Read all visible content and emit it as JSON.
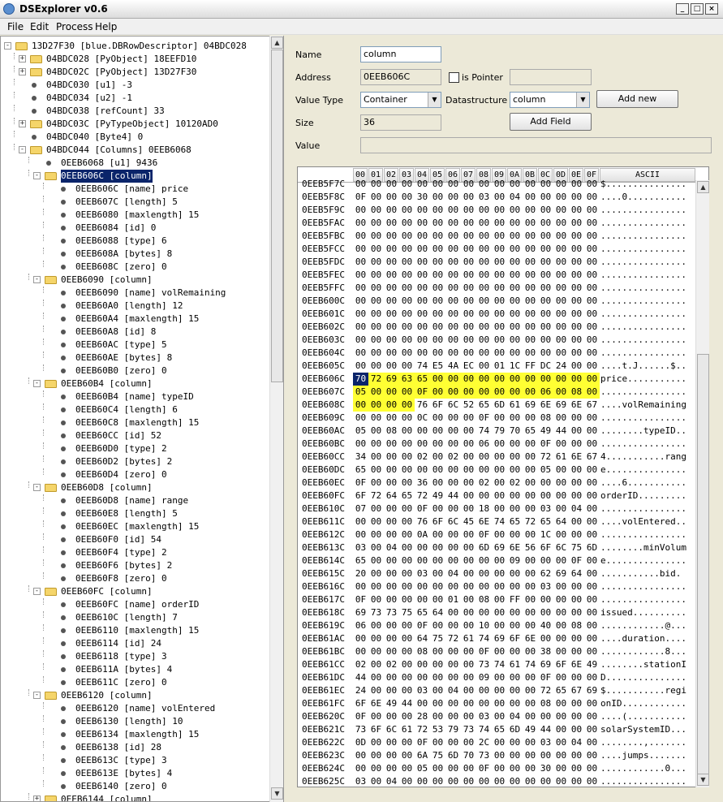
{
  "app": {
    "title": "DSExplorer v0.6"
  },
  "window_controls": {
    "minimize": "_",
    "maximize": "□",
    "close": "×"
  },
  "menu": [
    "File",
    "Edit",
    "Process",
    "Help"
  ],
  "tree": [
    {
      "depth": 0,
      "kind": "folder",
      "exp": "-",
      "text": "13D27F30 [blue.DBRowDescriptor] 04BDC028"
    },
    {
      "depth": 1,
      "kind": "folder",
      "exp": "+",
      "text": "04BDC028 [PyObject] 18EEFD10"
    },
    {
      "depth": 1,
      "kind": "folder",
      "exp": "+",
      "text": "04BDC02C [PyObject] 13D27F30"
    },
    {
      "depth": 1,
      "kind": "leaf",
      "text": "04BDC030 [u1] -3"
    },
    {
      "depth": 1,
      "kind": "leaf",
      "text": "04BDC034 [u2] -1"
    },
    {
      "depth": 1,
      "kind": "leaf",
      "text": "04BDC038 [refCount] 33"
    },
    {
      "depth": 1,
      "kind": "folder",
      "exp": "+",
      "text": "04BDC03C [PyTypeObject] 10120AD0"
    },
    {
      "depth": 1,
      "kind": "leaf",
      "text": "04BDC040 [Byte4] 0"
    },
    {
      "depth": 1,
      "kind": "folder",
      "exp": "-",
      "text": "04BDC044 [Columns] 0EEB6068"
    },
    {
      "depth": 2,
      "kind": "leaf",
      "text": "0EEB6068 [u1] 9436"
    },
    {
      "depth": 2,
      "kind": "folder",
      "exp": "-",
      "text": "0EEB606C [column]",
      "selected": true
    },
    {
      "depth": 3,
      "kind": "leaf",
      "text": "0EEB606C [name] price"
    },
    {
      "depth": 3,
      "kind": "leaf",
      "text": "0EEB607C [length] 5"
    },
    {
      "depth": 3,
      "kind": "leaf",
      "text": "0EEB6080 [maxlength] 15"
    },
    {
      "depth": 3,
      "kind": "leaf",
      "text": "0EEB6084 [id] 0"
    },
    {
      "depth": 3,
      "kind": "leaf",
      "text": "0EEB6088 [type] 6"
    },
    {
      "depth": 3,
      "kind": "leaf",
      "text": "0EEB608A [bytes] 8"
    },
    {
      "depth": 3,
      "kind": "leaf",
      "text": "0EEB608C [zero] 0"
    },
    {
      "depth": 2,
      "kind": "folder",
      "exp": "-",
      "text": "0EEB6090 [column]"
    },
    {
      "depth": 3,
      "kind": "leaf",
      "text": "0EEB6090 [name] volRemaining"
    },
    {
      "depth": 3,
      "kind": "leaf",
      "text": "0EEB60A0 [length] 12"
    },
    {
      "depth": 3,
      "kind": "leaf",
      "text": "0EEB60A4 [maxlength] 15"
    },
    {
      "depth": 3,
      "kind": "leaf",
      "text": "0EEB60A8 [id] 8"
    },
    {
      "depth": 3,
      "kind": "leaf",
      "text": "0EEB60AC [type] 5"
    },
    {
      "depth": 3,
      "kind": "leaf",
      "text": "0EEB60AE [bytes] 8"
    },
    {
      "depth": 3,
      "kind": "leaf",
      "text": "0EEB60B0 [zero] 0"
    },
    {
      "depth": 2,
      "kind": "folder",
      "exp": "-",
      "text": "0EEB60B4 [column]"
    },
    {
      "depth": 3,
      "kind": "leaf",
      "text": "0EEB60B4 [name] typeID"
    },
    {
      "depth": 3,
      "kind": "leaf",
      "text": "0EEB60C4 [length] 6"
    },
    {
      "depth": 3,
      "kind": "leaf",
      "text": "0EEB60C8 [maxlength] 15"
    },
    {
      "depth": 3,
      "kind": "leaf",
      "text": "0EEB60CC [id] 52"
    },
    {
      "depth": 3,
      "kind": "leaf",
      "text": "0EEB60D0 [type] 2"
    },
    {
      "depth": 3,
      "kind": "leaf",
      "text": "0EEB60D2 [bytes] 2"
    },
    {
      "depth": 3,
      "kind": "leaf",
      "text": "0EEB60D4 [zero] 0"
    },
    {
      "depth": 2,
      "kind": "folder",
      "exp": "-",
      "text": "0EEB60D8 [column]"
    },
    {
      "depth": 3,
      "kind": "leaf",
      "text": "0EEB60D8 [name] range"
    },
    {
      "depth": 3,
      "kind": "leaf",
      "text": "0EEB60E8 [length] 5"
    },
    {
      "depth": 3,
      "kind": "leaf",
      "text": "0EEB60EC [maxlength] 15"
    },
    {
      "depth": 3,
      "kind": "leaf",
      "text": "0EEB60F0 [id] 54"
    },
    {
      "depth": 3,
      "kind": "leaf",
      "text": "0EEB60F4 [type] 2"
    },
    {
      "depth": 3,
      "kind": "leaf",
      "text": "0EEB60F6 [bytes] 2"
    },
    {
      "depth": 3,
      "kind": "leaf",
      "text": "0EEB60F8 [zero] 0"
    },
    {
      "depth": 2,
      "kind": "folder",
      "exp": "-",
      "text": "0EEB60FC [column]"
    },
    {
      "depth": 3,
      "kind": "leaf",
      "text": "0EEB60FC [name] orderID"
    },
    {
      "depth": 3,
      "kind": "leaf",
      "text": "0EEB610C [length] 7"
    },
    {
      "depth": 3,
      "kind": "leaf",
      "text": "0EEB6110 [maxlength] 15"
    },
    {
      "depth": 3,
      "kind": "leaf",
      "text": "0EEB6114 [id] 24"
    },
    {
      "depth": 3,
      "kind": "leaf",
      "text": "0EEB6118 [type] 3"
    },
    {
      "depth": 3,
      "kind": "leaf",
      "text": "0EEB611A [bytes] 4"
    },
    {
      "depth": 3,
      "kind": "leaf",
      "text": "0EEB611C [zero] 0"
    },
    {
      "depth": 2,
      "kind": "folder",
      "exp": "-",
      "text": "0EEB6120 [column]"
    },
    {
      "depth": 3,
      "kind": "leaf",
      "text": "0EEB6120 [name] volEntered"
    },
    {
      "depth": 3,
      "kind": "leaf",
      "text": "0EEB6130 [length] 10"
    },
    {
      "depth": 3,
      "kind": "leaf",
      "text": "0EEB6134 [maxlength] 15"
    },
    {
      "depth": 3,
      "kind": "leaf",
      "text": "0EEB6138 [id] 28"
    },
    {
      "depth": 3,
      "kind": "leaf",
      "text": "0EEB613C [type] 3"
    },
    {
      "depth": 3,
      "kind": "leaf",
      "text": "0EEB613E [bytes] 4"
    },
    {
      "depth": 3,
      "kind": "leaf",
      "text": "0EEB6140 [zero] 0"
    },
    {
      "depth": 2,
      "kind": "folder",
      "exp": "+",
      "text": "0EEB6144 [column]"
    }
  ],
  "form": {
    "name_label": "Name",
    "name_value": "column",
    "address_label": "Address",
    "address_value": "0EEB606C",
    "is_pointer_label": "is Pointer",
    "pointer_value": "",
    "value_type_label": "Value Type",
    "value_type_value": "Container",
    "datastructure_label": "Datastructure",
    "datastructure_value": "column",
    "add_new_label": "Add new",
    "size_label": "Size",
    "size_value": "36",
    "add_field_label": "Add Field",
    "value_label": "Value",
    "value_value": ""
  },
  "hex": {
    "columns": [
      "00",
      "01",
      "02",
      "03",
      "04",
      "05",
      "06",
      "07",
      "08",
      "09",
      "0A",
      "0B",
      "0C",
      "0D",
      "0E",
      "0F"
    ],
    "ascii_header": "ASCII",
    "rows": [
      {
        "addr": "0EEB5F7C",
        "bytes": "00 00 00 00 00 00 00 00 00 00 00 00 00 00 00 00",
        "ascii": "$..............."
      },
      {
        "addr": "0EEB5F8C",
        "bytes": "0F 00 00 00 30 00 00 00 03 00 04 00 00 00 00 00",
        "ascii": "....0..........."
      },
      {
        "addr": "0EEB5F9C",
        "bytes": "00 00 00 00 00 00 00 00 00 00 00 00 00 00 00 00",
        "ascii": "................"
      },
      {
        "addr": "0EEB5FAC",
        "bytes": "00 00 00 00 00 00 00 00 00 00 00 00 00 00 00 00",
        "ascii": "................"
      },
      {
        "addr": "0EEB5FBC",
        "bytes": "00 00 00 00 00 00 00 00 00 00 00 00 00 00 00 00",
        "ascii": "................"
      },
      {
        "addr": "0EEB5FCC",
        "bytes": "00 00 00 00 00 00 00 00 00 00 00 00 00 00 00 00",
        "ascii": "................"
      },
      {
        "addr": "0EEB5FDC",
        "bytes": "00 00 00 00 00 00 00 00 00 00 00 00 00 00 00 00",
        "ascii": "................"
      },
      {
        "addr": "0EEB5FEC",
        "bytes": "00 00 00 00 00 00 00 00 00 00 00 00 00 00 00 00",
        "ascii": "................"
      },
      {
        "addr": "0EEB5FFC",
        "bytes": "00 00 00 00 00 00 00 00 00 00 00 00 00 00 00 00",
        "ascii": "................"
      },
      {
        "addr": "0EEB600C",
        "bytes": "00 00 00 00 00 00 00 00 00 00 00 00 00 00 00 00",
        "ascii": "................"
      },
      {
        "addr": "0EEB601C",
        "bytes": "00 00 00 00 00 00 00 00 00 00 00 00 00 00 00 00",
        "ascii": "................"
      },
      {
        "addr": "0EEB602C",
        "bytes": "00 00 00 00 00 00 00 00 00 00 00 00 00 00 00 00",
        "ascii": "................"
      },
      {
        "addr": "0EEB603C",
        "bytes": "00 00 00 00 00 00 00 00 00 00 00 00 00 00 00 00",
        "ascii": "................"
      },
      {
        "addr": "0EEB604C",
        "bytes": "00 00 00 00 00 00 00 00 00 00 00 00 00 00 00 00",
        "ascii": "................"
      },
      {
        "addr": "0EEB605C",
        "bytes": "00 00 00 00 74 E5 4A EC 00 01 1C FF DC 24 00 00",
        "ascii": "....t.J......$.."
      },
      {
        "addr": "0EEB606C",
        "bytes": "70 72 69 63 65 00 00 00 00 00 00 00 00 00 00 00",
        "ascii": "price...........",
        "hl_from": 0,
        "hl_to": 16
      },
      {
        "addr": "0EEB607C",
        "bytes": "05 00 00 00 0F 00 00 00 00 00 00 00 06 00 08 00",
        "ascii": "................",
        "hl_from": 0,
        "hl_to": 16
      },
      {
        "addr": "0EEB608C",
        "bytes": "00 00 00 00 76 6F 6C 52 65 6D 61 69 6E 69 6E 67",
        "ascii": "....volRemaining",
        "hl_from": 0,
        "hl_to": 4
      },
      {
        "addr": "0EEB609C",
        "bytes": "00 00 00 00 0C 00 00 00 0F 00 00 00 08 00 00 00",
        "ascii": "................"
      },
      {
        "addr": "0EEB60AC",
        "bytes": "05 00 08 00 00 00 00 00 74 79 70 65 49 44 00 00",
        "ascii": "........typeID.."
      },
      {
        "addr": "0EEB60BC",
        "bytes": "00 00 00 00 00 00 00 00 06 00 00 00 0F 00 00 00",
        "ascii": "................"
      },
      {
        "addr": "0EEB60CC",
        "bytes": "34 00 00 00 02 00 02 00 00 00 00 00 72 61 6E 67",
        "ascii": "4...........rang"
      },
      {
        "addr": "0EEB60DC",
        "bytes": "65 00 00 00 00 00 00 00 00 00 00 00 05 00 00 00",
        "ascii": "e..............."
      },
      {
        "addr": "0EEB60EC",
        "bytes": "0F 00 00 00 36 00 00 00 02 00 02 00 00 00 00 00",
        "ascii": "....6..........."
      },
      {
        "addr": "0EEB60FC",
        "bytes": "6F 72 64 65 72 49 44 00 00 00 00 00 00 00 00 00",
        "ascii": "orderID........."
      },
      {
        "addr": "0EEB610C",
        "bytes": "07 00 00 00 0F 00 00 00 18 00 00 00 03 00 04 00",
        "ascii": "................"
      },
      {
        "addr": "0EEB611C",
        "bytes": "00 00 00 00 76 6F 6C 45 6E 74 65 72 65 64 00 00",
        "ascii": "....volEntered.."
      },
      {
        "addr": "0EEB612C",
        "bytes": "00 00 00 00 0A 00 00 00 0F 00 00 00 1C 00 00 00",
        "ascii": "................"
      },
      {
        "addr": "0EEB613C",
        "bytes": "03 00 04 00 00 00 00 00 6D 69 6E 56 6F 6C 75 6D",
        "ascii": "........minVolum"
      },
      {
        "addr": "0EEB614C",
        "bytes": "65 00 00 00 00 00 00 00 00 00 09 00 00 00 0F 00",
        "ascii": "e..............."
      },
      {
        "addr": "0EEB615C",
        "bytes": "20 00 00 00 03 00 04 00 00 00 00 00 62 69 64 00",
        "ascii": " ...........bid."
      },
      {
        "addr": "0EEB616C",
        "bytes": "00 00 00 00 00 00 00 00 00 00 00 00 03 00 00 00",
        "ascii": "................"
      },
      {
        "addr": "0EEB617C",
        "bytes": "0F 00 00 00 00 00 01 00 08 00 FF 00 00 00 00 00",
        "ascii": "................"
      },
      {
        "addr": "0EEB618C",
        "bytes": "69 73 73 75 65 64 00 00 00 00 00 00 00 00 00 00",
        "ascii": "issued.........."
      },
      {
        "addr": "0EEB619C",
        "bytes": "06 00 00 00 0F 00 00 00 10 00 00 00 40 00 08 00",
        "ascii": "............@..."
      },
      {
        "addr": "0EEB61AC",
        "bytes": "00 00 00 00 64 75 72 61 74 69 6F 6E 00 00 00 00",
        "ascii": "....duration...."
      },
      {
        "addr": "0EEB61BC",
        "bytes": "00 00 00 00 08 00 00 00 0F 00 00 00 38 00 00 00",
        "ascii": "............8..."
      },
      {
        "addr": "0EEB61CC",
        "bytes": "02 00 02 00 00 00 00 00 73 74 61 74 69 6F 6E 49",
        "ascii": "........stationI"
      },
      {
        "addr": "0EEB61DC",
        "bytes": "44 00 00 00 00 00 00 00 09 00 00 00 0F 00 00 00",
        "ascii": "D..............."
      },
      {
        "addr": "0EEB61EC",
        "bytes": "24 00 00 00 03 00 04 00 00 00 00 00 72 65 67 69",
        "ascii": "$...........regi"
      },
      {
        "addr": "0EEB61FC",
        "bytes": "6F 6E 49 44 00 00 00 00 00 00 00 00 08 00 00 00",
        "ascii": "onID............"
      },
      {
        "addr": "0EEB620C",
        "bytes": "0F 00 00 00 28 00 00 00 03 00 04 00 00 00 00 00",
        "ascii": "....(..........."
      },
      {
        "addr": "0EEB621C",
        "bytes": "73 6F 6C 61 72 53 79 73 74 65 6D 49 44 00 00 00",
        "ascii": "solarSystemID..."
      },
      {
        "addr": "0EEB622C",
        "bytes": "0D 00 00 00 0F 00 00 00 2C 00 00 00 03 00 04 00",
        "ascii": "........,......."
      },
      {
        "addr": "0EEB623C",
        "bytes": "00 00 00 00 6A 75 6D 70 73 00 00 00 00 00 00 00",
        "ascii": "....jumps......."
      },
      {
        "addr": "0EEB624C",
        "bytes": "00 00 00 00 05 00 00 00 0F 00 00 00 30 00 00 00",
        "ascii": "............0..."
      },
      {
        "addr": "0EEB625C",
        "bytes": "03 00 04 00 00 00 00 00 00 00 00 00 00 00 00 00",
        "ascii": "................"
      }
    ]
  }
}
